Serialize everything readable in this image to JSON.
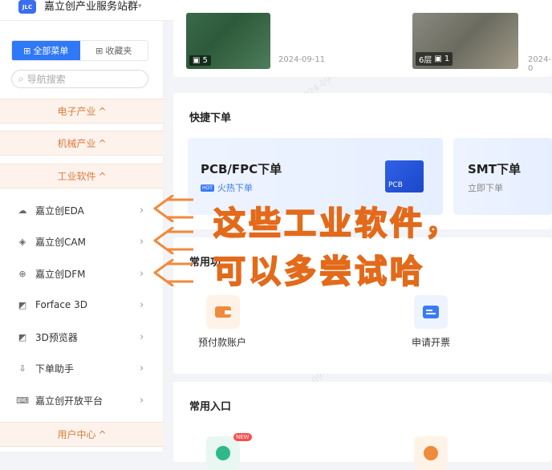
{
  "header": {
    "logo_text": "JLC",
    "title": "嘉立创产业服务站群"
  },
  "sidebar": {
    "tabs": [
      {
        "label": "全部菜单"
      },
      {
        "label": "收藏夹"
      }
    ],
    "search_placeholder": "导航搜索",
    "groups": {
      "electronics": "电子产业",
      "mechanical": "机械产业",
      "software": "工业软件",
      "user": "用户中心"
    },
    "items": [
      {
        "label": "嘉立创EDA",
        "icon": "cloud-icon"
      },
      {
        "label": "嘉立创CAM",
        "icon": "diamond-icon"
      },
      {
        "label": "嘉立创DFM",
        "icon": "zoom-icon"
      },
      {
        "label": "Forface 3D",
        "icon": "cube-icon"
      },
      {
        "label": "3D预览器",
        "icon": "cube-icon"
      },
      {
        "label": "下单助手",
        "icon": "download-icon"
      },
      {
        "label": "嘉立创开放平台",
        "icon": "code-icon"
      }
    ]
  },
  "gallery": [
    {
      "count": "5",
      "date": "2024-09-11"
    },
    {
      "layers": "6层",
      "count": "1",
      "date": "2024-0"
    }
  ],
  "quick_order": {
    "title": "快捷下单",
    "promos": [
      {
        "title": "PCB/FPC下单",
        "hot": "HOT",
        "sub": "火热下单",
        "img_label": "PCB"
      },
      {
        "title": "SMT下单",
        "sub": "立即下单"
      }
    ]
  },
  "common_functions": {
    "title": "常用功",
    "items": [
      {
        "label": "预付款账户"
      },
      {
        "label": "申请开票"
      }
    ]
  },
  "common_entry": {
    "title": "常用入口",
    "new_badge": "NEW"
  },
  "overlay_text": {
    "line1": "这些工业软件，",
    "line2": "可以多尝试哈"
  },
  "watermark": "10024 2024-09-12 15:13",
  "colors": {
    "accent": "#2f78f6",
    "group_text": "#e0793a",
    "overlay_stroke": "#e36a1a"
  }
}
